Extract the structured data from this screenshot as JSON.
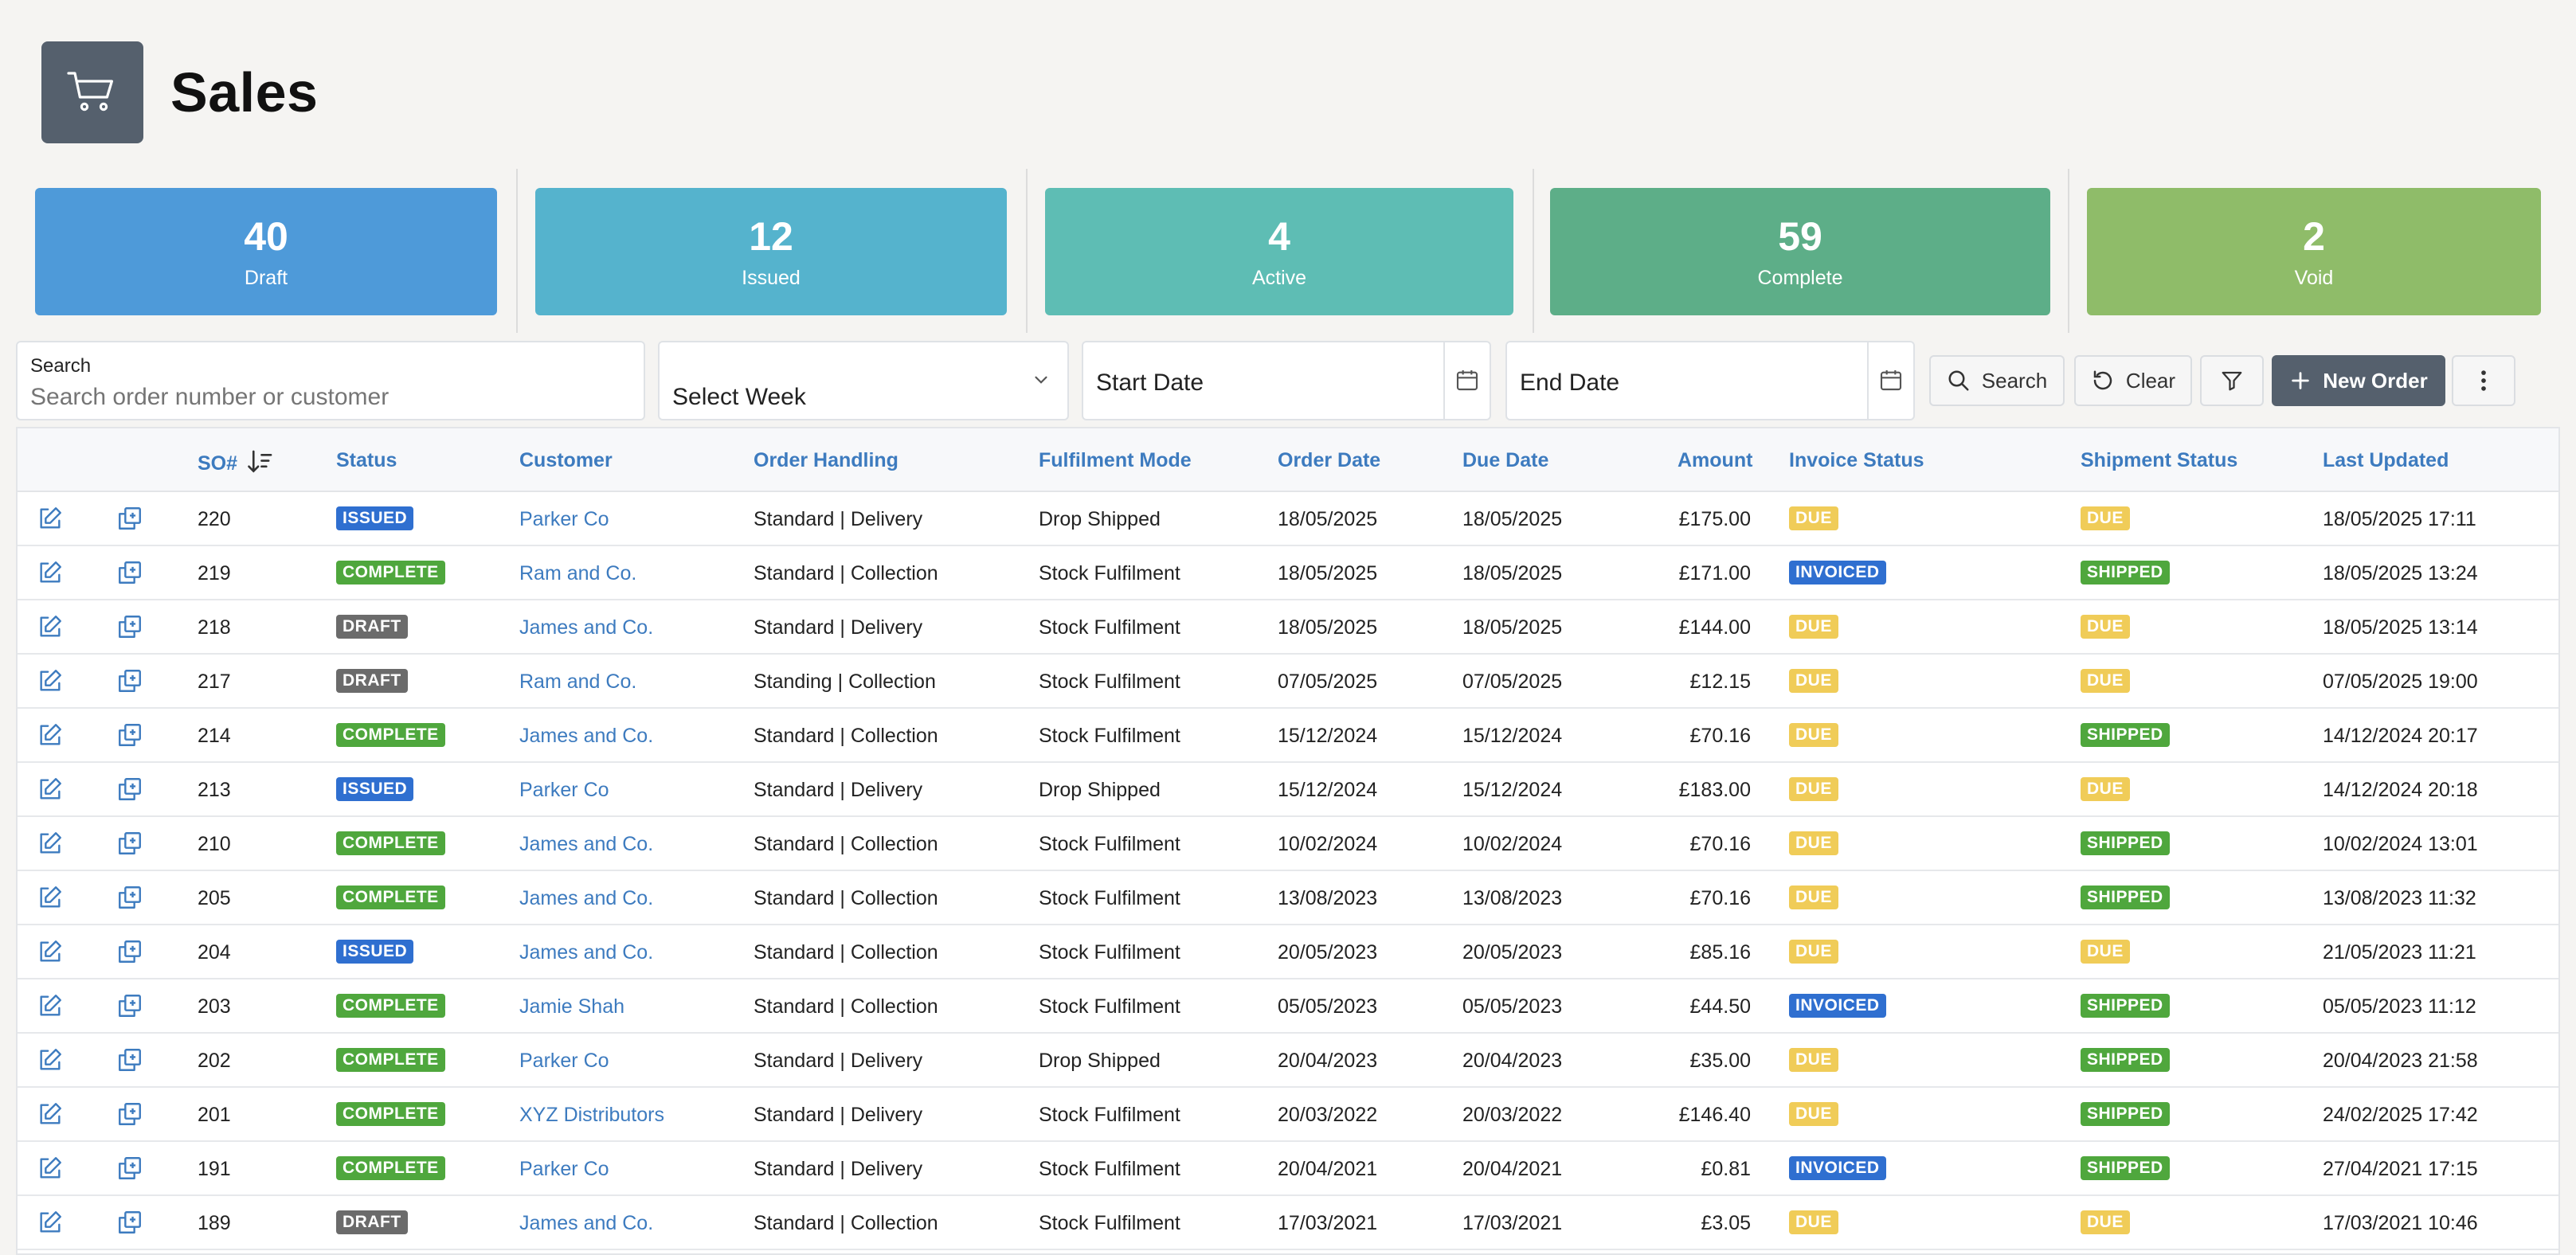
{
  "page": {
    "title": "Sales",
    "icon": "shopping-cart-icon"
  },
  "stats": [
    {
      "value": "40",
      "label": "Draft",
      "color": "#4e9ad9"
    },
    {
      "value": "12",
      "label": "Issued",
      "color": "#55b3cd"
    },
    {
      "value": "4",
      "label": "Active",
      "color": "#5ebdb4"
    },
    {
      "value": "59",
      "label": "Complete",
      "color": "#5dae88"
    },
    {
      "value": "2",
      "label": "Void",
      "color": "#8fbc69"
    }
  ],
  "toolbar": {
    "search_label": "Search",
    "search_placeholder": "Search order number or customer",
    "week_select": "Select Week",
    "start_date": "Start Date",
    "end_date": "End Date",
    "search_button": "Search",
    "clear_button": "Clear",
    "new_order_button": "New Order"
  },
  "table": {
    "headers": {
      "so": "SO#",
      "status": "Status",
      "customer": "Customer",
      "handling": "Order Handling",
      "fulfilment": "Fulfilment Mode",
      "order_date": "Order Date",
      "due_date": "Due Date",
      "amount": "Amount",
      "invoice": "Invoice Status",
      "shipment": "Shipment Status",
      "updated": "Last Updated"
    },
    "sort_icon": "sort-descending-icon",
    "rows": [
      {
        "so": "220",
        "status": "ISSUED",
        "customer": "Parker Co",
        "handling": "Standard | Delivery",
        "fulfilment": "Drop Shipped",
        "order_date": "18/05/2025",
        "due_date": "18/05/2025",
        "amount": "£175.00",
        "invoice": "DUE",
        "shipment": "DUE",
        "updated": "18/05/2025 17:11"
      },
      {
        "so": "219",
        "status": "COMPLETE",
        "customer": "Ram and Co.",
        "handling": "Standard | Collection",
        "fulfilment": "Stock Fulfilment",
        "order_date": "18/05/2025",
        "due_date": "18/05/2025",
        "amount": "£171.00",
        "invoice": "INVOICED",
        "shipment": "SHIPPED",
        "updated": "18/05/2025 13:24"
      },
      {
        "so": "218",
        "status": "DRAFT",
        "customer": "James and Co.",
        "handling": "Standard | Delivery",
        "fulfilment": "Stock Fulfilment",
        "order_date": "18/05/2025",
        "due_date": "18/05/2025",
        "amount": "£144.00",
        "invoice": "DUE",
        "shipment": "DUE",
        "updated": "18/05/2025 13:14"
      },
      {
        "so": "217",
        "status": "DRAFT",
        "customer": "Ram and Co.",
        "handling": "Standing | Collection",
        "fulfilment": "Stock Fulfilment",
        "order_date": "07/05/2025",
        "due_date": "07/05/2025",
        "amount": "£12.15",
        "invoice": "DUE",
        "shipment": "DUE",
        "updated": "07/05/2025 19:00"
      },
      {
        "so": "214",
        "status": "COMPLETE",
        "customer": "James and Co.",
        "handling": "Standard | Collection",
        "fulfilment": "Stock Fulfilment",
        "order_date": "15/12/2024",
        "due_date": "15/12/2024",
        "amount": "£70.16",
        "invoice": "DUE",
        "shipment": "SHIPPED",
        "updated": "14/12/2024 20:17"
      },
      {
        "so": "213",
        "status": "ISSUED",
        "customer": "Parker Co",
        "handling": "Standard | Delivery",
        "fulfilment": "Drop Shipped",
        "order_date": "15/12/2024",
        "due_date": "15/12/2024",
        "amount": "£183.00",
        "invoice": "DUE",
        "shipment": "DUE",
        "updated": "14/12/2024 20:18"
      },
      {
        "so": "210",
        "status": "COMPLETE",
        "customer": "James and Co.",
        "handling": "Standard | Collection",
        "fulfilment": "Stock Fulfilment",
        "order_date": "10/02/2024",
        "due_date": "10/02/2024",
        "amount": "£70.16",
        "invoice": "DUE",
        "shipment": "SHIPPED",
        "updated": "10/02/2024 13:01"
      },
      {
        "so": "205",
        "status": "COMPLETE",
        "customer": "James and Co.",
        "handling": "Standard | Collection",
        "fulfilment": "Stock Fulfilment",
        "order_date": "13/08/2023",
        "due_date": "13/08/2023",
        "amount": "£70.16",
        "invoice": "DUE",
        "shipment": "SHIPPED",
        "updated": "13/08/2023 11:32"
      },
      {
        "so": "204",
        "status": "ISSUED",
        "customer": "James and Co.",
        "handling": "Standard | Collection",
        "fulfilment": "Stock Fulfilment",
        "order_date": "20/05/2023",
        "due_date": "20/05/2023",
        "amount": "£85.16",
        "invoice": "DUE",
        "shipment": "DUE",
        "updated": "21/05/2023 11:21"
      },
      {
        "so": "203",
        "status": "COMPLETE",
        "customer": "Jamie Shah",
        "handling": "Standard | Collection",
        "fulfilment": "Stock Fulfilment",
        "order_date": "05/05/2023",
        "due_date": "05/05/2023",
        "amount": "£44.50",
        "invoice": "INVOICED",
        "shipment": "SHIPPED",
        "updated": "05/05/2023 11:12"
      },
      {
        "so": "202",
        "status": "COMPLETE",
        "customer": "Parker Co",
        "handling": "Standard | Delivery",
        "fulfilment": "Drop Shipped",
        "order_date": "20/04/2023",
        "due_date": "20/04/2023",
        "amount": "£35.00",
        "invoice": "DUE",
        "shipment": "SHIPPED",
        "updated": "20/04/2023 21:58"
      },
      {
        "so": "201",
        "status": "COMPLETE",
        "customer": "XYZ Distributors",
        "handling": "Standard | Delivery",
        "fulfilment": "Stock Fulfilment",
        "order_date": "20/03/2022",
        "due_date": "20/03/2022",
        "amount": "£146.40",
        "invoice": "DUE",
        "shipment": "SHIPPED",
        "updated": "24/02/2025 17:42"
      },
      {
        "so": "191",
        "status": "COMPLETE",
        "customer": "Parker Co",
        "handling": "Standard | Delivery",
        "fulfilment": "Stock Fulfilment",
        "order_date": "20/04/2021",
        "due_date": "20/04/2021",
        "amount": "£0.81",
        "invoice": "INVOICED",
        "shipment": "SHIPPED",
        "updated": "27/04/2021 17:15"
      },
      {
        "so": "189",
        "status": "DRAFT",
        "customer": "James and Co.",
        "handling": "Standard | Collection",
        "fulfilment": "Stock Fulfilment",
        "order_date": "17/03/2021",
        "due_date": "17/03/2021",
        "amount": "£3.05",
        "invoice": "DUE",
        "shipment": "DUE",
        "updated": "17/03/2021 10:46"
      }
    ]
  },
  "badge_colors": {
    "ISSUED": "#2f6fd0",
    "COMPLETE": "#4fa73d",
    "DRAFT": "#6b6b6b",
    "DUE": "#f0cc58",
    "INVOICED": "#2f6fd0",
    "SHIPPED": "#4fa73d"
  },
  "icons": {
    "edit": "edit-icon",
    "duplicate": "copy-icon",
    "filter": "filter-icon",
    "more": "more-vertical-icon",
    "calendar": "calendar-icon"
  }
}
